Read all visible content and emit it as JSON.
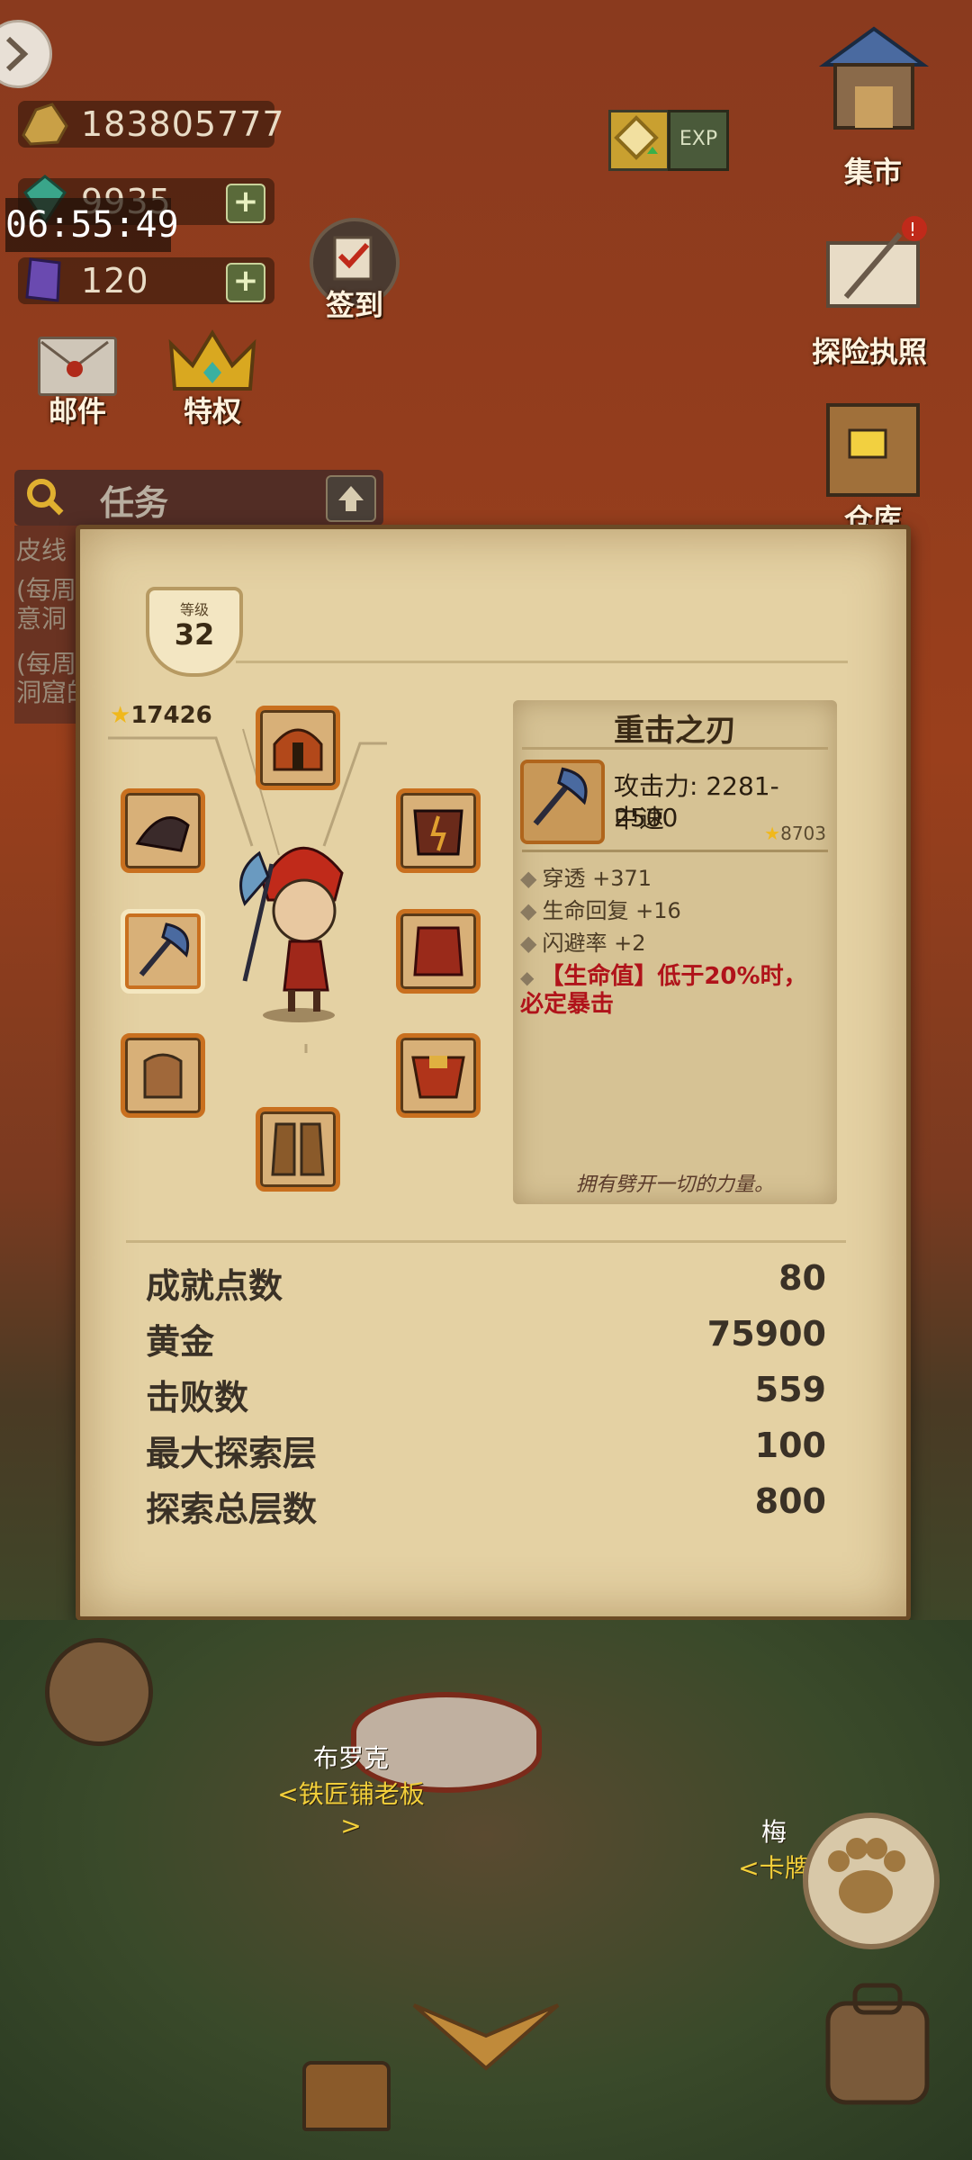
{
  "resources": {
    "gold": "183805777",
    "gems": "9935",
    "crystals": "120"
  },
  "clock": "06:55:49",
  "top_buttons": {
    "checkin": "签到",
    "mail": "邮件",
    "privilege": "特权",
    "market": "集市",
    "license": "探险执照",
    "warehouse": "仓库",
    "exp_badge": "EXP"
  },
  "task": {
    "label": "任务",
    "lines": [
      "皮线",
      "(每周",
      "意洞",
      "(每周",
      "洞窟的"
    ]
  },
  "character": {
    "level_title": "等级",
    "level": "32",
    "power": "17426"
  },
  "item": {
    "name": "重击之刃",
    "attack": "攻击力: 2281-2500",
    "speed": "中速",
    "power": "8703",
    "stats": [
      "穿透 +371",
      "生命回复 +16",
      "闪避率 +2"
    ],
    "special": "【生命值】低于20%时，必定暴击",
    "flavor": "拥有劈开一切的力量。"
  },
  "summary": [
    {
      "label": "成就点数",
      "value": "80"
    },
    {
      "label": "黄金",
      "value": "75900"
    },
    {
      "label": "击败数",
      "value": "559"
    },
    {
      "label": "最大探索层",
      "value": "100"
    },
    {
      "label": "探索总层数",
      "value": "800"
    }
  ],
  "npcs": {
    "blacksmith_name": "布罗克",
    "blacksmith_role": "<铁匠铺老板>",
    "card_name": "梅",
    "card_role": "<卡牌"
  },
  "colors": {
    "parchment": "#e4d1a3",
    "special_text": "#b0131a",
    "accent_orange": "#c9701f"
  }
}
